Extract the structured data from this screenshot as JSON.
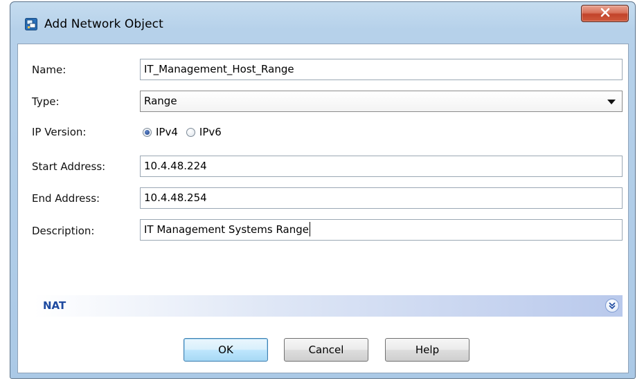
{
  "window": {
    "title": "Add Network Object",
    "app_icon": "network-object-icon",
    "close_icon": "close-icon",
    "colors": {
      "frame": "#b6d1ea",
      "close_button": "#c9553a",
      "section_label": "#1e4aa0"
    }
  },
  "form": {
    "name": {
      "label": "Name:",
      "value": "IT_Management_Host_Range"
    },
    "type": {
      "label": "Type:",
      "selected": "Range"
    },
    "ip_version": {
      "label": "IP Version:",
      "options": [
        {
          "label": "IPv4",
          "checked": true
        },
        {
          "label": "IPv6",
          "checked": false
        }
      ]
    },
    "start_address": {
      "label": "Start Address:",
      "value": "10.4.48.224"
    },
    "end_address": {
      "label": "End Address:",
      "value": "10.4.48.254"
    },
    "description": {
      "label": "Description:",
      "value": "IT Management Systems Range"
    }
  },
  "nat": {
    "label": "NAT",
    "icon": "expand-chevrons-icon"
  },
  "buttons": {
    "ok": "OK",
    "cancel": "Cancel",
    "help": "Help"
  }
}
